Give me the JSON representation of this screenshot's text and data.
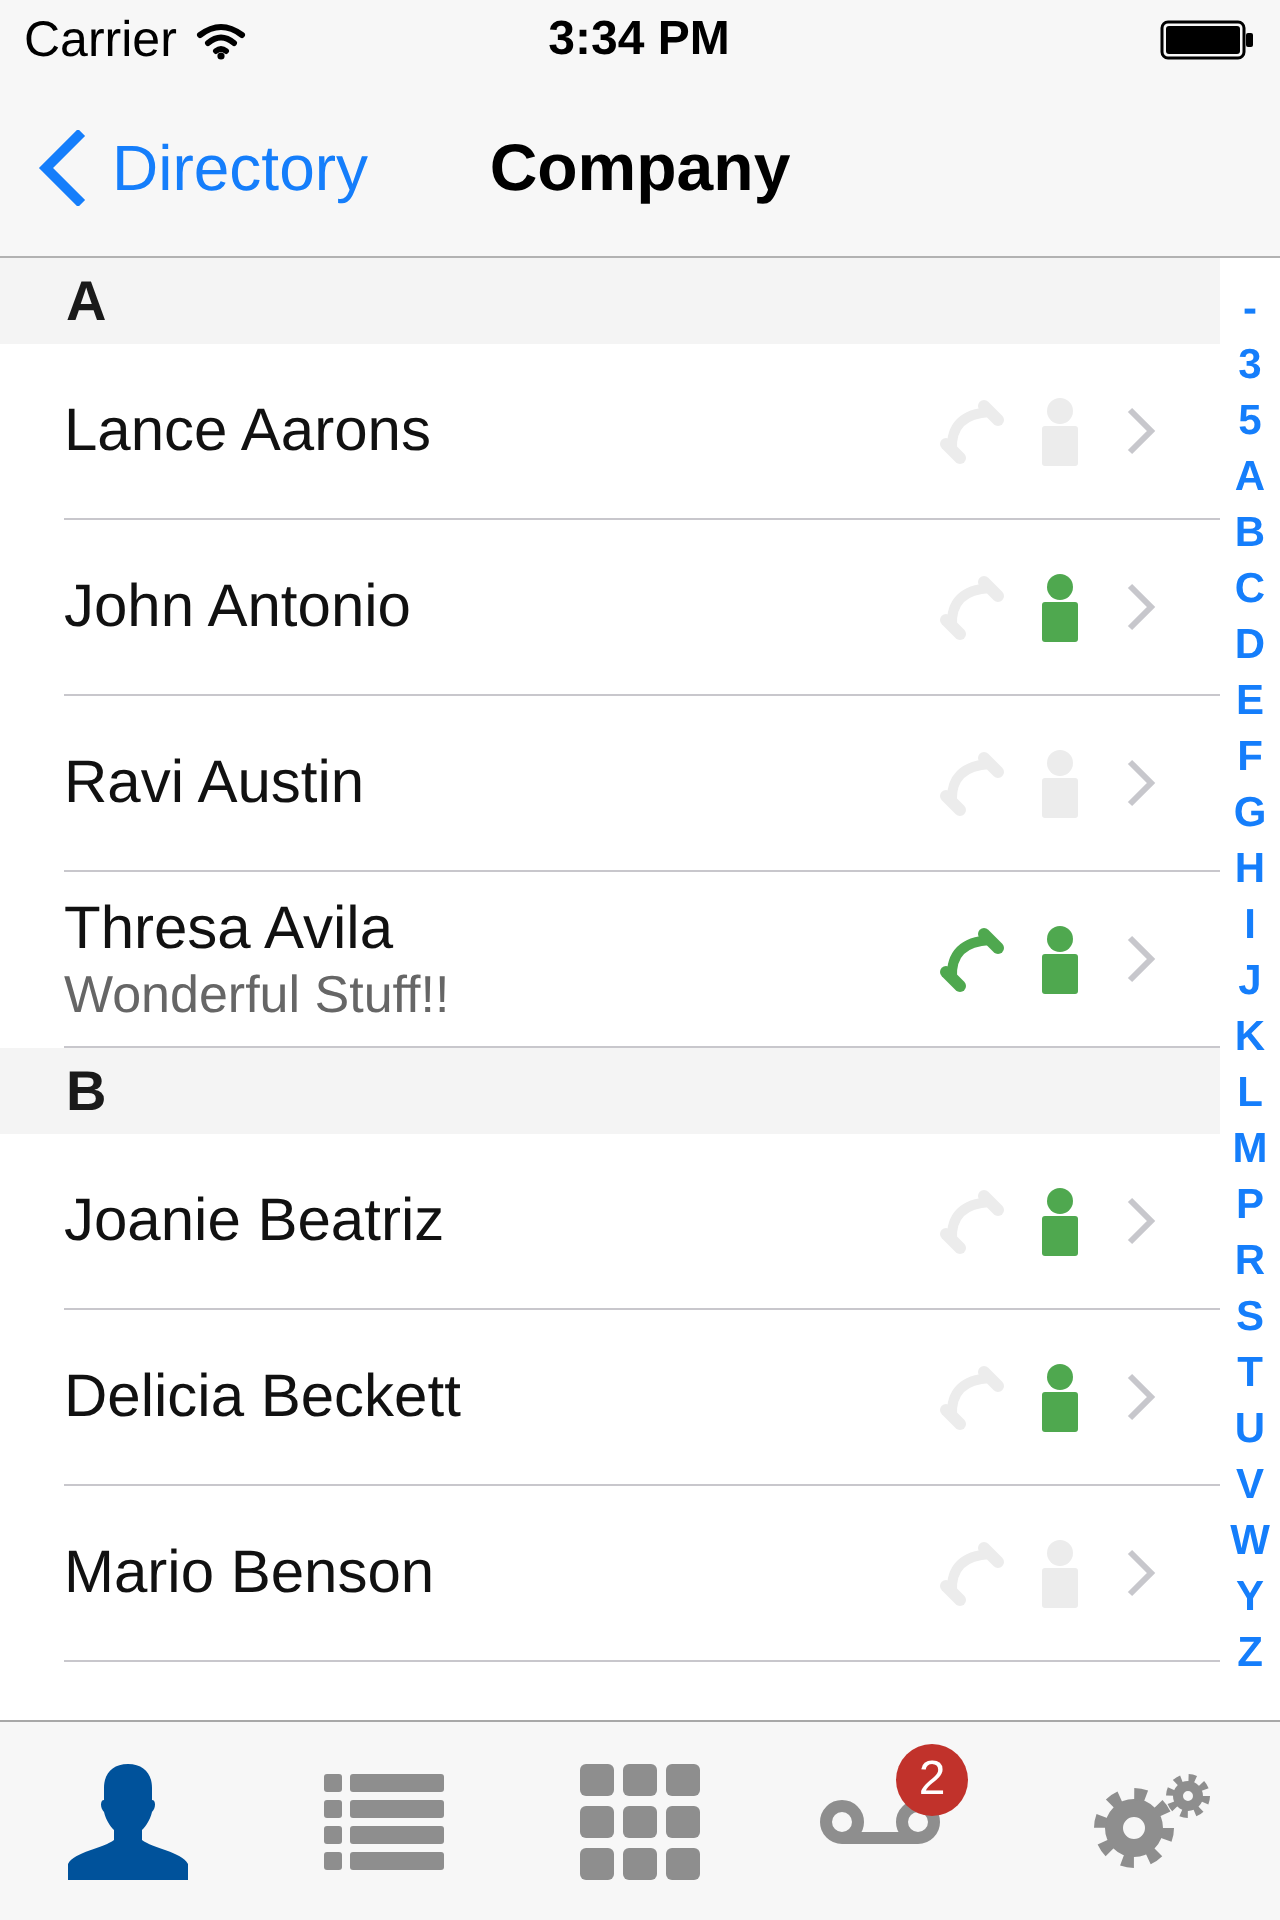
{
  "status_bar": {
    "carrier": "Carrier",
    "time": "3:34 PM"
  },
  "nav_bar": {
    "back": "Directory",
    "title": "Company"
  },
  "sections": [
    {
      "letter": "A",
      "contacts": [
        {
          "name": "Lance Aarons",
          "on_call": false,
          "available": false
        },
        {
          "name": "John Antonio",
          "on_call": false,
          "available": true
        },
        {
          "name": "Ravi Austin",
          "on_call": false,
          "available": false
        },
        {
          "name": "Thresa Avila",
          "status": "Wonderful Stuff!!",
          "on_call": true,
          "available": true
        }
      ]
    },
    {
      "letter": "B",
      "contacts": [
        {
          "name": "Joanie Beatriz",
          "on_call": false,
          "available": true
        },
        {
          "name": "Delicia Beckett",
          "on_call": false,
          "available": true
        },
        {
          "name": "Mario Benson",
          "on_call": false,
          "available": false
        }
      ]
    }
  ],
  "index": [
    "-",
    "3",
    "5",
    "A",
    "B",
    "C",
    "D",
    "E",
    "F",
    "G",
    "H",
    "I",
    "J",
    "K",
    "L",
    "M",
    "P",
    "R",
    "S",
    "T",
    "U",
    "V",
    "W",
    "Y",
    "Z"
  ],
  "tab_bar": {
    "tabs": [
      {
        "kind": "contacts",
        "selected": true
      },
      {
        "kind": "list",
        "selected": false
      },
      {
        "kind": "keypad",
        "selected": false
      },
      {
        "kind": "voicemail",
        "selected": false,
        "badge": "2"
      },
      {
        "kind": "settings",
        "selected": false
      }
    ]
  }
}
